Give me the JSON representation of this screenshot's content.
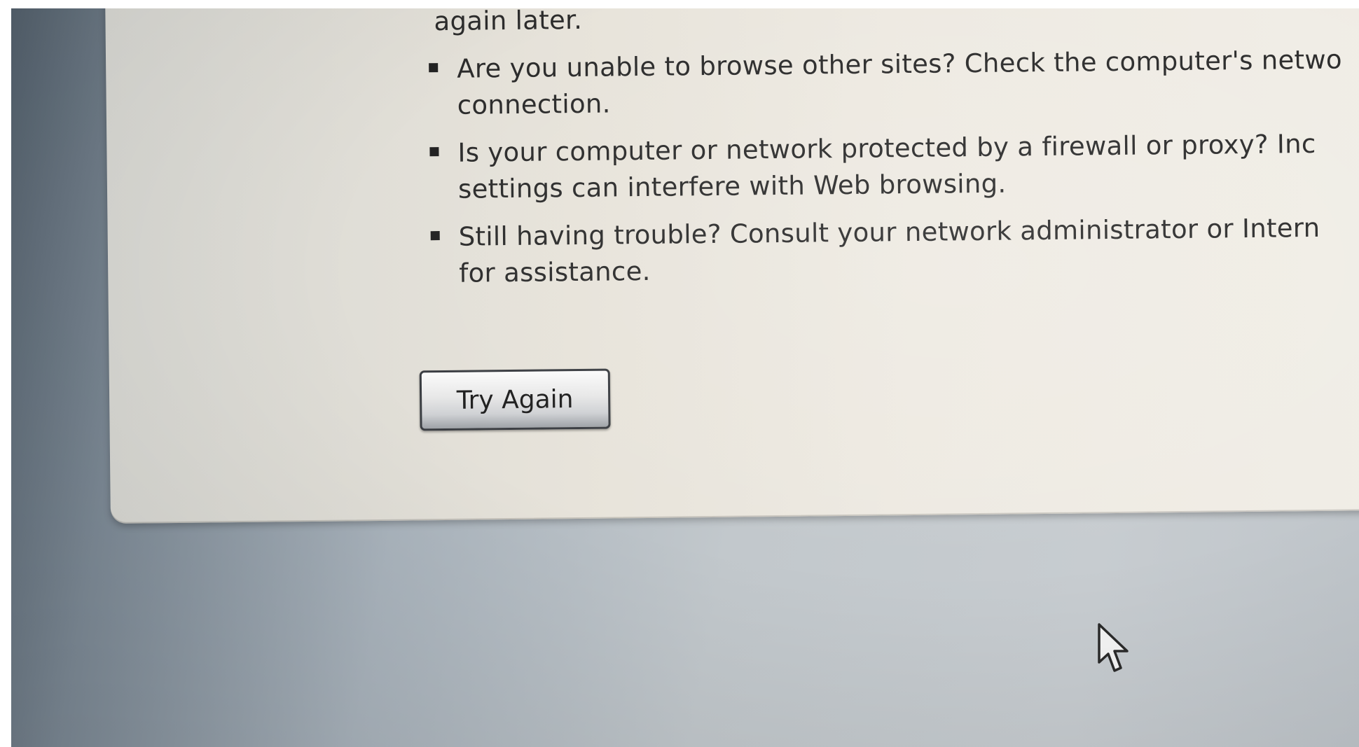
{
  "error_page": {
    "partial_line": "again later.",
    "suggestions": [
      {
        "line1": "Are you unable to browse other sites? Check the computer's netwo",
        "line2": "connection."
      },
      {
        "line1": "Is your computer or network protected by a firewall or proxy? Inc",
        "line2": "settings can interfere with Web browsing."
      },
      {
        "line1": "Still having trouble? Consult your network administrator or Intern",
        "line2": "for assistance."
      }
    ],
    "try_again_label": "Try Again"
  },
  "icons": {
    "bullet": "square-bullet-icon",
    "pointer": "mouse-pointer-icon"
  },
  "colors": {
    "panel_background": "#ece8e0",
    "desktop_background": "#b4bcc4",
    "text": "#2c2c2c",
    "button_border": "#3a3d42"
  }
}
